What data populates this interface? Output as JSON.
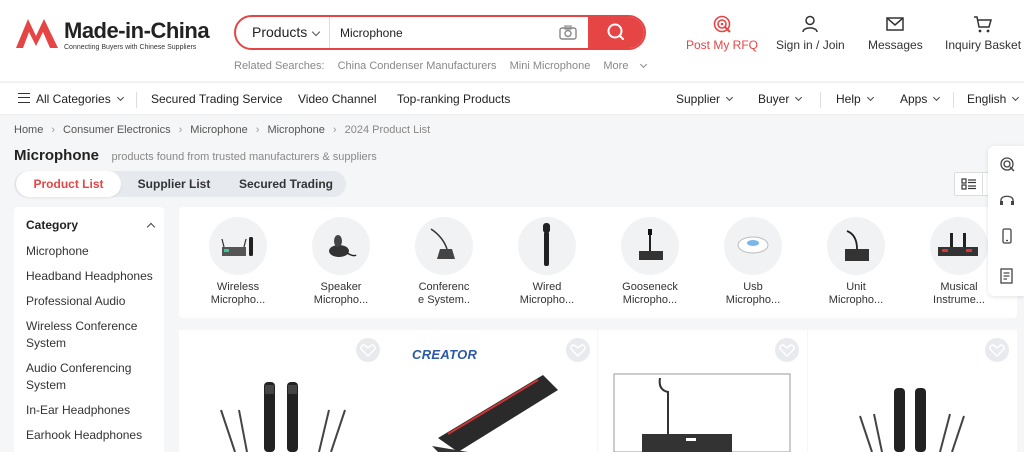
{
  "logo": {
    "name": "Made-in-China",
    "tagline": "Connecting Buyers with Chinese Suppliers"
  },
  "search": {
    "category": "Products",
    "query": "Microphone",
    "related_label": "Related Searches:",
    "related": [
      "China Condenser Manufacturers",
      "Mini Microphone"
    ],
    "more": "More"
  },
  "header_actions": {
    "rfq": "Post My RFQ",
    "signin": "Sign in / Join",
    "messages": "Messages",
    "basket": "Inquiry Basket"
  },
  "nav": {
    "all_categories": "All Categories",
    "left": [
      "Secured Trading Service",
      "Video Channel",
      "Top-ranking Products"
    ],
    "right": [
      "Supplier",
      "Buyer",
      "Help",
      "Apps",
      "English"
    ]
  },
  "breadcrumb": [
    "Home",
    "Consumer Electronics",
    "Microphone",
    "Microphone",
    "2024 Product List"
  ],
  "page": {
    "title": "Microphone",
    "subtitle": "products found from  trusted manufacturers & suppliers"
  },
  "tabs": [
    "Product List",
    "Supplier List",
    "Secured Trading"
  ],
  "sidebar": {
    "title": "Category",
    "items": [
      "Microphone",
      "Headband Headphones",
      "Professional Audio",
      "Wireless Conference System",
      "Audio Conferencing System",
      "In-Ear Headphones",
      "Earhook Headphones"
    ]
  },
  "categories": [
    {
      "line1": "Wireless",
      "line2": "Micropho..."
    },
    {
      "line1": "Speaker",
      "line2": "Micropho..."
    },
    {
      "line1": "Conferenc",
      "line2": "e System.."
    },
    {
      "line1": "Wired",
      "line2": "Micropho..."
    },
    {
      "line1": "Gooseneck",
      "line2": "Micropho..."
    },
    {
      "line1": "Usb",
      "line2": "Micropho..."
    },
    {
      "line1": "Unit",
      "line2": "Micropho..."
    },
    {
      "line1": "Musical",
      "line2": "Instrume..."
    }
  ],
  "products": [
    {
      "brand": ""
    },
    {
      "brand": "CREATOR"
    },
    {
      "brand": ""
    },
    {
      "brand": ""
    }
  ],
  "colors": {
    "accent": "#e64545",
    "brand_blue": "#2c5aa7"
  }
}
